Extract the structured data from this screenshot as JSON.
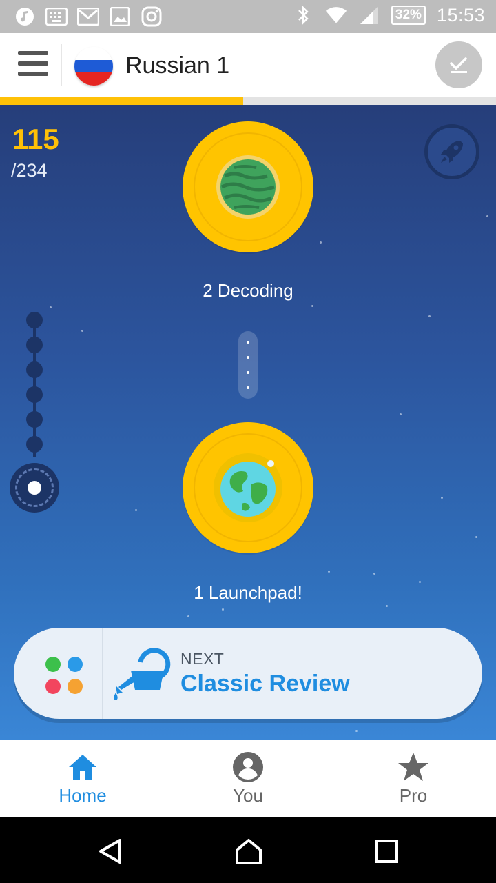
{
  "status_bar": {
    "battery": "32%",
    "time": "15:53",
    "icons": [
      "music-icon",
      "keyboard-icon",
      "gmail-icon",
      "gallery-icon",
      "instagram-icon",
      "bluetooth-icon",
      "wifi-icon",
      "signal-icon",
      "battery-icon"
    ]
  },
  "header": {
    "title": "Russian 1",
    "flag_icon": "russia-flag-icon",
    "menu_icon": "hamburger-menu-icon",
    "action_icon": "checkmark-icon"
  },
  "progress": {
    "fraction": 0.49,
    "color": "#ffc107"
  },
  "score": {
    "value": "115",
    "total": "/234"
  },
  "levels": [
    {
      "label": "2 Decoding",
      "icon": "green-planet-icon"
    },
    {
      "label": "1 Launchpad!",
      "icon": "earth-icon"
    }
  ],
  "next_card": {
    "label": "NEXT",
    "title": "Classic Review",
    "icon": "watering-can-icon"
  },
  "bottom_nav": {
    "items": [
      {
        "label": "Home",
        "icon": "home-icon",
        "active": true
      },
      {
        "label": "You",
        "icon": "profile-icon",
        "active": false
      },
      {
        "label": "Pro",
        "icon": "star-icon",
        "active": false
      }
    ],
    "active_color": "#1f8de0",
    "inactive_color": "#666666"
  },
  "system_nav": [
    "back-icon",
    "home-outline-icon",
    "recents-icon"
  ]
}
